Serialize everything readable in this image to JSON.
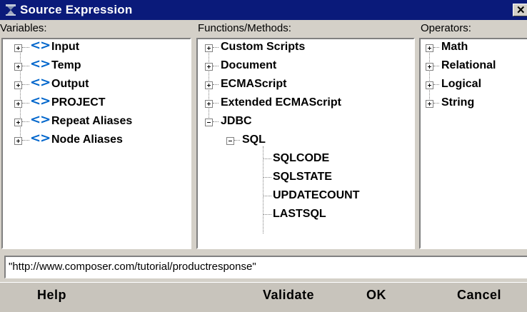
{
  "window": {
    "title": "Source Expression",
    "close_label": "✕",
    "icon": "composer-app-icon",
    "title_color": "#0a1a7a"
  },
  "variables": {
    "label": "Variables:",
    "items": [
      "Input",
      "Temp",
      "Output",
      "PROJECT",
      "Repeat Aliases",
      "Node Aliases"
    ],
    "icon_glyph": "<>",
    "icon_color": "#0066cc"
  },
  "functions": {
    "label": "Functions/Methods:",
    "items": [
      "Custom Scripts",
      "Document",
      "ECMAScript",
      "Extended ECMAScript",
      "JDBC"
    ],
    "jdbc_children": [
      "SQL"
    ],
    "sql_children": [
      "SQLCODE",
      "SQLSTATE",
      "UPDATECOUNT",
      "LASTSQL"
    ]
  },
  "operators": {
    "label": "Operators:",
    "items": [
      "Math",
      "Relational",
      "Logical",
      "String"
    ]
  },
  "expression": {
    "value": "\"http://www.composer.com/tutorial/productresponse\""
  },
  "buttons": {
    "help": "Help",
    "validate": "Validate",
    "ok": "OK",
    "cancel": "Cancel"
  }
}
